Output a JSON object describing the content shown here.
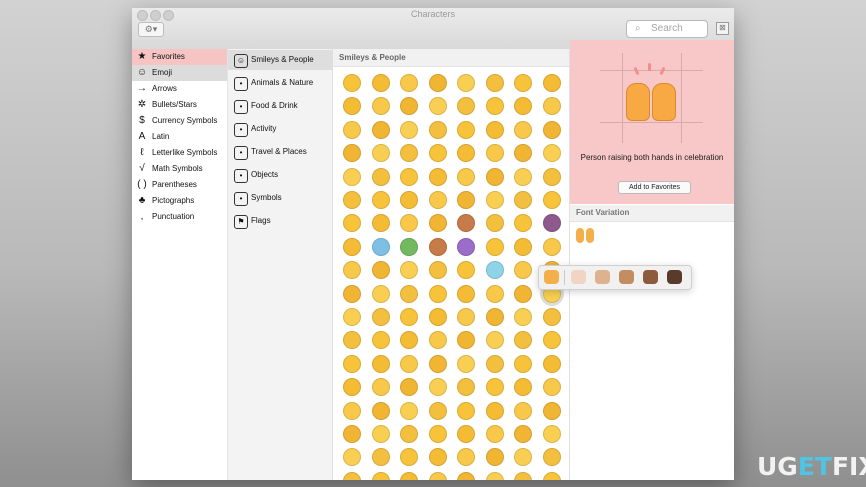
{
  "window": {
    "title": "Characters",
    "gear_icon": "gear-icon",
    "search_placeholder": "Search",
    "collapse_icon": "window-collapse-icon"
  },
  "sidebar": {
    "items": [
      {
        "icon": "★",
        "label": "Favorites",
        "state": "favorites"
      },
      {
        "icon": "☺",
        "label": "Emoji",
        "state": "selected"
      },
      {
        "icon": "→",
        "label": "Arrows",
        "state": ""
      },
      {
        "icon": "✲",
        "label": "Bullets/Stars",
        "state": ""
      },
      {
        "icon": "$",
        "label": "Currency Symbols",
        "state": ""
      },
      {
        "icon": "A",
        "label": "Latin",
        "state": ""
      },
      {
        "icon": "ℓ",
        "label": "Letterlike Symbols",
        "state": ""
      },
      {
        "icon": "√",
        "label": "Math Symbols",
        "state": ""
      },
      {
        "icon": "( )",
        "label": "Parentheses",
        "state": ""
      },
      {
        "icon": "♣",
        "label": "Pictographs",
        "state": ""
      },
      {
        "icon": ",",
        "label": "Punctuation",
        "state": ""
      }
    ]
  },
  "categories": {
    "items": [
      {
        "icon": "☺",
        "label": "Smileys & People",
        "selected": true
      },
      {
        "icon": "•",
        "label": "Animals & Nature",
        "selected": false
      },
      {
        "icon": "•",
        "label": "Food & Drink",
        "selected": false
      },
      {
        "icon": "•",
        "label": "Activity",
        "selected": false
      },
      {
        "icon": "•",
        "label": "Travel & Places",
        "selected": false
      },
      {
        "icon": "•",
        "label": "Objects",
        "selected": false
      },
      {
        "icon": "•",
        "label": "Symbols",
        "selected": false
      },
      {
        "icon": "⚑",
        "label": "Flags",
        "selected": false
      }
    ]
  },
  "emoji_grid": {
    "heading": "Smileys & People",
    "rows": 18,
    "cols": 8,
    "selected_index": 79
  },
  "details": {
    "description": "Person raising both hands in celebration",
    "add_favorites_label": "Add to Favorites",
    "font_variation_label": "Font Variation"
  },
  "popover": {
    "items": 6
  },
  "watermark": {
    "prefix": "UG",
    "middle": "ET",
    "suffix": "FIX"
  },
  "colors": {
    "emoji_yellow": "#f6c33a",
    "favorite_bg": "#f8c8c8",
    "selection_bg": "#dcdcdc",
    "accent_blue": "#4ec5e4"
  }
}
